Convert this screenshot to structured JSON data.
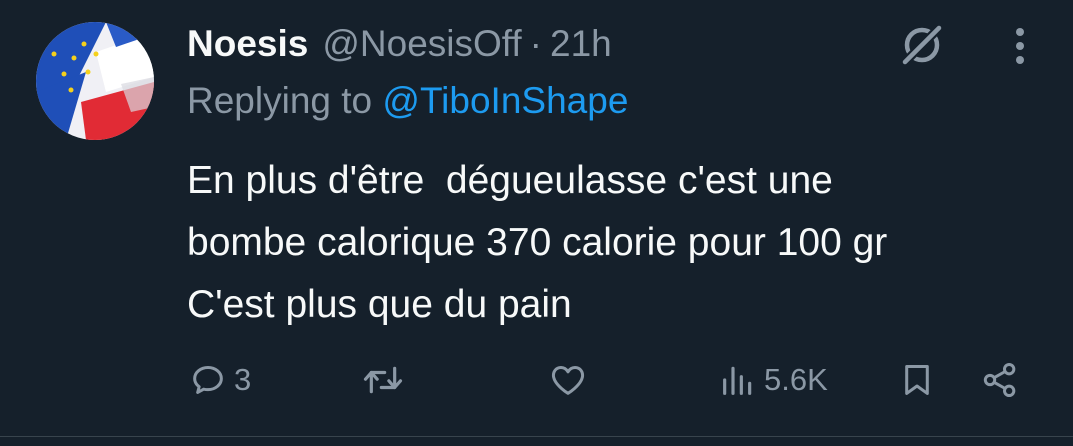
{
  "tweet": {
    "author": {
      "name": "Noesis",
      "handle": "@NoesisOff",
      "separator": "·",
      "time": "21h"
    },
    "reply": {
      "prefix": "Replying to",
      "target": "@TiboInShape"
    },
    "text_lines": [
      "En plus d'être  dégueulasse c'est une",
      "bombe calorique 370 calorie pour 100 gr",
      "C'est plus que du pain"
    ],
    "actions": {
      "replies": "3",
      "retweets": "",
      "likes": "",
      "views": "5.6K"
    },
    "icons": {
      "grok": "grok-icon",
      "more": "more-vertical-icon",
      "reply": "reply-icon",
      "retweet": "retweet-icon",
      "like": "heart-icon",
      "views": "views-icon",
      "bookmark": "bookmark-icon",
      "share": "share-icon"
    },
    "colors": {
      "background": "#15202b",
      "text": "#f7f9f9",
      "muted": "#8b98a5",
      "accent": "#1d9bf0"
    }
  }
}
